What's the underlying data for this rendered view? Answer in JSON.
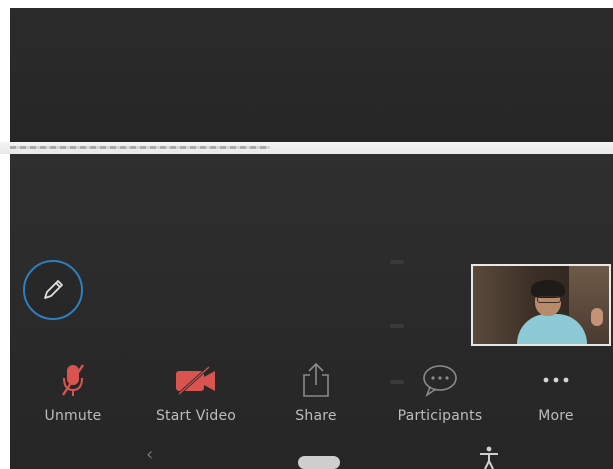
{
  "toolbar": {
    "unmute_label": "Unmute",
    "start_video_label": "Start Video",
    "share_label": "Share",
    "participants_label": "Participants",
    "more_label": "More"
  },
  "icons": {
    "annotate": "pencil-icon",
    "unmute": "microphone-muted-icon",
    "start_video": "video-camera-off-icon",
    "share": "share-upload-icon",
    "participants": "chat-bubble-icon",
    "more": "more-dots-icon",
    "nav_back": "back-chevron-icon",
    "nav_home": "home-pill-icon",
    "accessibility": "accessibility-icon"
  },
  "colors": {
    "background": "#2b2b2b",
    "muted_red": "#d9534f",
    "label_grey": "#bdbdbd",
    "annotate_ring": "#2c7fc0"
  }
}
